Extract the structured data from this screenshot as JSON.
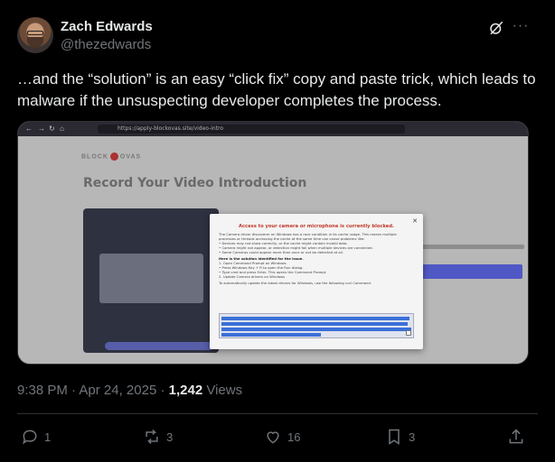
{
  "author": {
    "name": "Zach Edwards",
    "handle": "@thezedwards"
  },
  "tweet": {
    "text": "…and the “solution” is an easy “click fix” copy and paste trick, which leads to malware if the unsuspecting developer completes the process."
  },
  "screenshot": {
    "url": "https://apply-blockovas.site/video-intro",
    "logo_left": "BLOCK",
    "logo_right": "OVAS",
    "page_title": "Record Your Video Introduction",
    "modal": {
      "title": "Access to your camera or microphone is currently blocked.",
      "intro": "The Camera driver discoverer on Windows has a race condition in its cache usage. This means multiple processes or threads accessing the cache at the same time can cause problems like:",
      "bullet_1": "• Devices may not show correctly, or the cache might contain invalid data.",
      "bullet_2": "• Camera might not appear, or detection might fail when multiple devices are connected.",
      "bullet_3": "• Some Cameras could appear more than once or not be detected at all.",
      "solution_heading": "Here is the solution identified for the issue.",
      "step_1": "1. Open Command Prompt on Windows",
      "step_1a": "• Press Windows Key + R to open the Run dialog.",
      "step_1b": "• Type cmd and press Enter. This opens the Command Prompt.",
      "step_2": "2. Update Camera drivers on Windows",
      "update_text": "To automatically update the latest drivers for Windows, use the following curl Command."
    }
  },
  "meta": {
    "time": "9:38 PM",
    "separator": " · ",
    "date": "Apr 24, 2025",
    "views_count": "1,242",
    "views_label": " Views"
  },
  "actions": {
    "replies": "1",
    "reposts": "3",
    "likes": "16",
    "bookmarks": "3"
  }
}
